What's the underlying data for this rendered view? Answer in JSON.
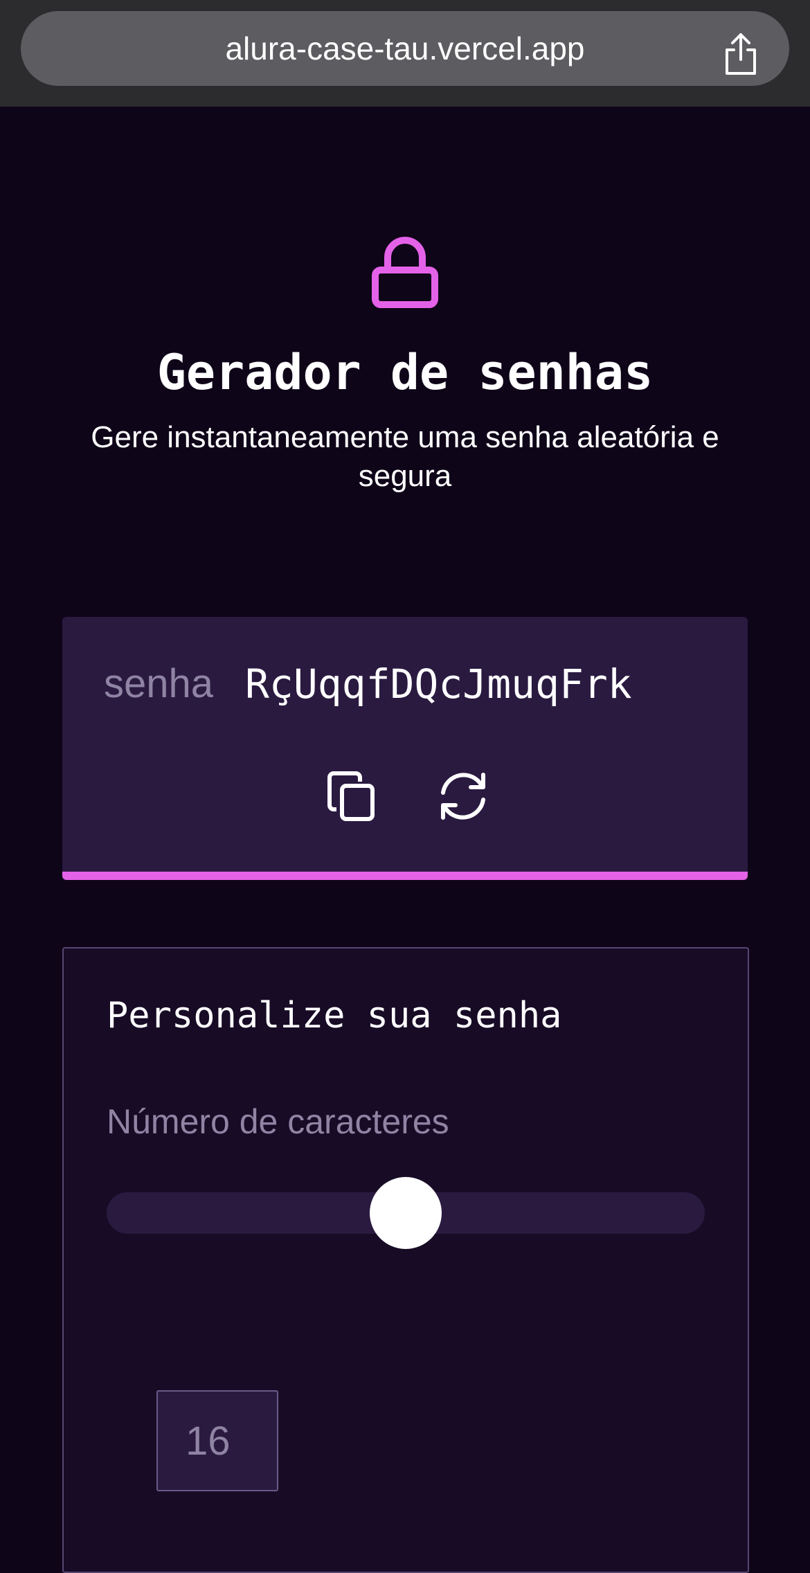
{
  "browser": {
    "url": "alura-case-tau.vercel.app",
    "share_icon": "share-icon"
  },
  "header": {
    "icon": "lock-icon",
    "title": "Gerador de senhas",
    "subtitle": "Gere instantaneamente uma senha aleatória e segura"
  },
  "password": {
    "label": "senha",
    "value": "RçUqqfDQcJmuqFrk",
    "copy_icon": "copy-icon",
    "refresh_icon": "refresh-icon",
    "strength_color": "#e462e8"
  },
  "settings": {
    "title": "Personalize sua senha",
    "length_label": "Número de caracteres",
    "length_value": "16",
    "slider_fraction": 0.5
  },
  "colors": {
    "background": "#0f0519",
    "card": "#2a1a40",
    "accent": "#e462e8",
    "muted_text": "#8f84a3"
  }
}
